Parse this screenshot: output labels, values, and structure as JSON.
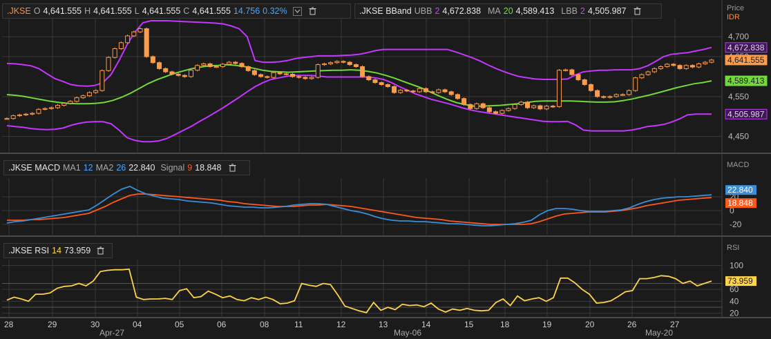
{
  "colors": {
    "bg": "#1b1b1b",
    "grid": "#3a3a3a",
    "candle": "#ff9c4a",
    "ubb": "#c437ff",
    "ma": "#72d93a",
    "macd": "#3a8fd9",
    "signal": "#ff5a1e",
    "rsi": "#ffd34a"
  },
  "price_header": {
    "symbol": ".JKSE",
    "o_label": "O",
    "o": "4,641.555",
    "h_label": "H",
    "h": "4,641.555",
    "l_label": "L",
    "l": "4,641.555",
    "c_label": "C",
    "c": "4,641.555",
    "chg": "14.756",
    "pct": "0.32%"
  },
  "bband_header": {
    "symbol": ".JKSE BBand",
    "ubb_label": "UBB",
    "ubb_period": "2",
    "ubb": "4,672.838",
    "ma_label": "MA",
    "ma_period": "20",
    "ma": "4,589.413",
    "lbb_label": "LBB",
    "lbb_period": "2",
    "lbb": "4,505.987"
  },
  "macd_header": {
    "symbol": ".JKSE MACD",
    "ma1_label": "MA1",
    "ma1": "12",
    "ma2_label": "MA2",
    "ma2": "26",
    "value": "22.840",
    "signal_label": "Signal",
    "signal_period": "9",
    "signal": "18.848"
  },
  "rsi_header": {
    "symbol": ".JKSE RSI",
    "period": "14",
    "value": "73.959"
  },
  "axis": {
    "price_title": "Price",
    "price_unit": "IDR",
    "macd_title": "MACD",
    "rsi_title": "RSI"
  },
  "price_tags": [
    {
      "value": "4,672.838",
      "color": "#c437ff",
      "text": "#e8c8ff",
      "y": 4672.838
    },
    {
      "value": "4,641.555",
      "color": "#ff9c4a",
      "text": "#1b1b1b",
      "y": 4641.555
    },
    {
      "value": "4,589.413",
      "color": "#72d93a",
      "text": "#1b1b1b",
      "y": 4589.413
    },
    {
      "value": "4,505.987",
      "color": "#c437ff",
      "text": "#e8c8ff",
      "y": 4505.987
    }
  ],
  "macd_tags": [
    {
      "value": "22.840",
      "color": "#3a8fd9",
      "y": 22.84
    },
    {
      "value": "18.848",
      "color": "#ff5a1e",
      "y": 18.848
    }
  ],
  "rsi_tag": {
    "value": "73.959",
    "color": "#ffd34a",
    "y": 73.959
  },
  "chart_data": [
    {
      "type": "candlestick",
      "name": "price",
      "ylim": [
        4420,
        4740
      ],
      "yticks": [
        4450,
        4550,
        4650,
        4700
      ],
      "x_day_labels": [
        "28",
        "29",
        "30",
        "04",
        "05",
        "06",
        "08",
        "11",
        "12",
        "13",
        "14",
        "15",
        "18",
        "19",
        "20",
        "26",
        "27"
      ],
      "x_month_labels": [
        "Apr-27",
        "May-06",
        "May-20"
      ],
      "close": [
        4495,
        4502,
        4504,
        4506,
        4508,
        4518,
        4520,
        4522,
        4528,
        4533,
        4538,
        4547,
        4552,
        4560,
        4565,
        4615,
        4648,
        4670,
        4685,
        4702,
        4712,
        4720,
        4650,
        4635,
        4620,
        4612,
        4606,
        4603,
        4600,
        4616,
        4628,
        4632,
        4625,
        4625,
        4631,
        4636,
        4633,
        4625,
        4615,
        4605,
        4600,
        4598,
        4610,
        4607,
        4606,
        4600,
        4598,
        4595,
        4598,
        4630,
        4632,
        4635,
        4638,
        4636,
        4630,
        4625,
        4600,
        4592,
        4585,
        4580,
        4575,
        4560,
        4566,
        4564,
        4562,
        4570,
        4562,
        4560,
        4567,
        4562,
        4555,
        4545,
        4530,
        4520,
        4532,
        4522,
        4512,
        4508,
        4515,
        4520,
        4530,
        4536,
        4522,
        4527,
        4519,
        4526,
        4525,
        4616,
        4617,
        4605,
        4592,
        4580,
        4565,
        4550,
        4548,
        4550,
        4555,
        4555,
        4565,
        4597,
        4605,
        4612,
        4620,
        4625,
        4631,
        4628,
        4620,
        4628,
        4624,
        4632,
        4636,
        4641.555
      ],
      "ubb": [
        4633,
        4632,
        4630,
        4627,
        4620,
        4607,
        4595,
        4588,
        4580,
        4577,
        4576,
        4578,
        4585,
        4605,
        4640,
        4680,
        4712,
        4735,
        4740,
        4740,
        4740,
        4739,
        4738,
        4737,
        4736,
        4735,
        4734,
        4732,
        4727,
        4720,
        4700,
        4640,
        4636,
        4636,
        4637,
        4640,
        4645,
        4648,
        4650,
        4652,
        4652,
        4652,
        4653,
        4654,
        4656,
        4660,
        4665,
        4668,
        4668,
        4668,
        4668,
        4668,
        4668,
        4668,
        4668,
        4668,
        4662,
        4655,
        4648,
        4640,
        4630,
        4621,
        4613,
        4606,
        4600,
        4597,
        4594,
        4593,
        4593,
        4593,
        4594,
        4604,
        4612,
        4614,
        4616,
        4616,
        4617,
        4617,
        4617,
        4620,
        4627,
        4638,
        4650,
        4656,
        4658,
        4660,
        4664,
        4668,
        4673
      ],
      "ma": [
        4555,
        4553,
        4550,
        4546,
        4542,
        4538,
        4535,
        4533,
        4532,
        4532,
        4533,
        4535,
        4540,
        4548,
        4558,
        4570,
        4582,
        4592,
        4600,
        4608,
        4614,
        4620,
        4624,
        4627,
        4628,
        4630,
        4628,
        4625,
        4621,
        4616,
        4613,
        4612,
        4611,
        4612,
        4613,
        4614,
        4615,
        4616,
        4616,
        4617,
        4616,
        4613,
        4609,
        4603,
        4596,
        4588,
        4580,
        4572,
        4562,
        4552,
        4543,
        4535,
        4530,
        4526,
        4526,
        4527,
        4528,
        4530,
        4532,
        4535,
        4538,
        4539,
        4539,
        4539,
        4539,
        4538,
        4537,
        4536,
        4536,
        4537,
        4540,
        4544,
        4549,
        4554,
        4560,
        4566,
        4572,
        4577,
        4582,
        4585,
        4589.413
      ],
      "lbb": [
        4477,
        4475,
        4473,
        4470,
        4468,
        4467,
        4468,
        4471,
        4478,
        4483,
        4486,
        4487,
        4487,
        4482,
        4466,
        4447,
        4440,
        4437,
        4437,
        4439,
        4445,
        4455,
        4465,
        4475,
        4487,
        4498,
        4510,
        4522,
        4535,
        4548,
        4562,
        4575,
        4585,
        4593,
        4597,
        4601,
        4603,
        4603,
        4603,
        4601,
        4599,
        4599,
        4599,
        4599,
        4599,
        4599,
        4597,
        4593,
        4585,
        4575,
        4566,
        4557,
        4550,
        4543,
        4538,
        4533,
        4527,
        4521,
        4516,
        4512,
        4509,
        4506,
        4503,
        4500,
        4497,
        4494,
        4491,
        4488,
        4487,
        4487,
        4488,
        4479,
        4466,
        4464,
        4464,
        4464,
        4464,
        4464,
        4466,
        4470,
        4475,
        4477,
        4480,
        4486,
        4494,
        4504,
        4506,
        4506,
        4506
      ],
      "last_close": "4,641.555"
    },
    {
      "type": "line",
      "name": "MACD",
      "ylim": [
        -33,
        43
      ],
      "yticks": [
        -20,
        0,
        20
      ],
      "series": [
        {
          "name": "MACD",
          "values": [
            -18,
            -16,
            -15,
            -13,
            -11,
            -9,
            -7,
            -5,
            -3,
            -1,
            1,
            8,
            16,
            24,
            31,
            35,
            29,
            24,
            21,
            18,
            17,
            16,
            14,
            13,
            12,
            11,
            9,
            7,
            6,
            5,
            5,
            4,
            4,
            5,
            6,
            8,
            9,
            10,
            10,
            9,
            6,
            3,
            0,
            -2,
            -5,
            -9,
            -12,
            -14,
            -15,
            -15,
            -16,
            -16,
            -17,
            -18,
            -19,
            -19,
            -20,
            -21,
            -22,
            -22,
            -21,
            -20,
            -19,
            -17,
            -14,
            -6,
            0,
            3,
            3,
            2,
            0,
            -1,
            -1,
            -1,
            0,
            1,
            4,
            9,
            13,
            16,
            18,
            19,
            20,
            20,
            21,
            22,
            22.84
          ]
        },
        {
          "name": "Signal",
          "values": [
            -14,
            -14,
            -14,
            -13,
            -13,
            -12,
            -11,
            -10,
            -8,
            -6,
            -4,
            1,
            6,
            12,
            17,
            22,
            24,
            24,
            23,
            22,
            21,
            20,
            19,
            18,
            17,
            16,
            15,
            13,
            12,
            10,
            9,
            8,
            7,
            6,
            6,
            6,
            7,
            8,
            8,
            9,
            8,
            7,
            6,
            4,
            2,
            0,
            -2,
            -4,
            -6,
            -8,
            -10,
            -11,
            -12,
            -13,
            -15,
            -16,
            -17,
            -18,
            -19,
            -20,
            -20,
            -20,
            -20,
            -20,
            -19,
            -16,
            -12,
            -8,
            -5,
            -4,
            -3,
            -2,
            -2,
            -2,
            -1,
            0,
            2,
            4,
            7,
            9,
            11,
            13,
            15,
            16,
            17,
            18,
            18.848
          ]
        }
      ]
    },
    {
      "type": "line",
      "name": "RSI",
      "ylim": [
        15,
        110
      ],
      "yticks": [
        20,
        40,
        60,
        100
      ],
      "values": [
        42,
        47,
        44,
        40,
        52,
        52,
        54,
        62,
        65,
        66,
        70,
        66,
        74,
        90,
        92,
        93,
        93,
        94,
        47,
        43,
        44,
        44,
        45,
        43,
        58,
        61,
        46,
        48,
        57,
        52,
        46,
        49,
        43,
        41,
        46,
        43,
        47,
        43,
        36,
        37,
        41,
        70,
        67,
        65,
        70,
        68,
        51,
        32,
        28,
        24,
        21,
        38,
        25,
        30,
        26,
        35,
        33,
        34,
        31,
        37,
        27,
        22,
        27,
        25,
        28,
        25,
        24,
        25,
        38,
        44,
        33,
        49,
        41,
        44,
        46,
        40,
        46,
        79,
        79,
        71,
        60,
        52,
        37,
        38,
        41,
        48,
        56,
        58,
        78,
        78,
        80,
        83,
        82,
        78,
        70,
        74,
        66,
        70,
        73.959
      ]
    }
  ]
}
